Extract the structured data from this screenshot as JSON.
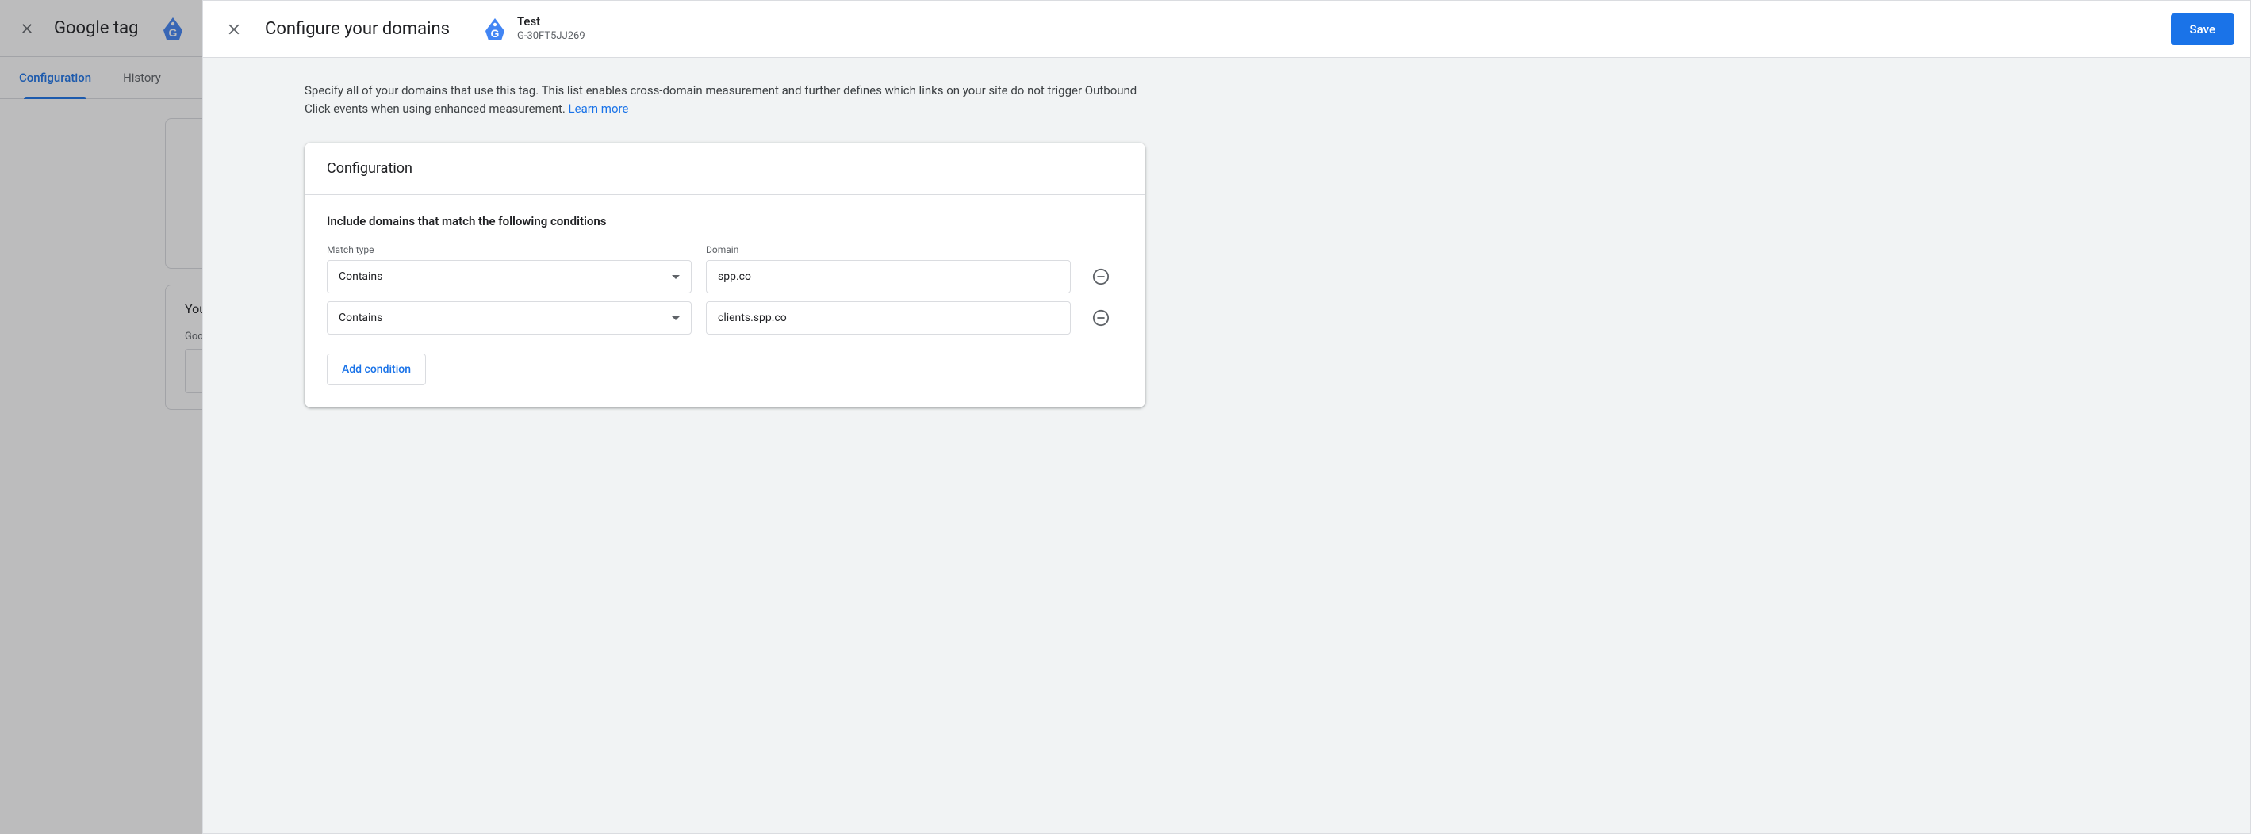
{
  "background": {
    "title": "Google tag",
    "tabs": [
      {
        "label": "Configuration",
        "active": true
      },
      {
        "label": "History",
        "active": false
      }
    ],
    "label_you": "You",
    "label_google": "Goo"
  },
  "panel": {
    "title": "Configure your domains",
    "account": {
      "name": "Test",
      "id": "G-30FT5JJ269"
    },
    "save_label": "Save",
    "intro_text_before": "Specify all of your domains that use this tag. This list enables cross-domain measurement and further defines which links on your site do not trigger Outbound Click events when using enhanced measurement. ",
    "learn_more": "Learn more"
  },
  "config": {
    "card_title": "Configuration",
    "section_label": "Include domains that match the following conditions",
    "match_header": "Match type",
    "domain_header": "Domain",
    "conditions": [
      {
        "match_type": "Contains",
        "domain": "spp.co"
      },
      {
        "match_type": "Contains",
        "domain": "clients.spp.co"
      }
    ],
    "add_label": "Add condition"
  }
}
